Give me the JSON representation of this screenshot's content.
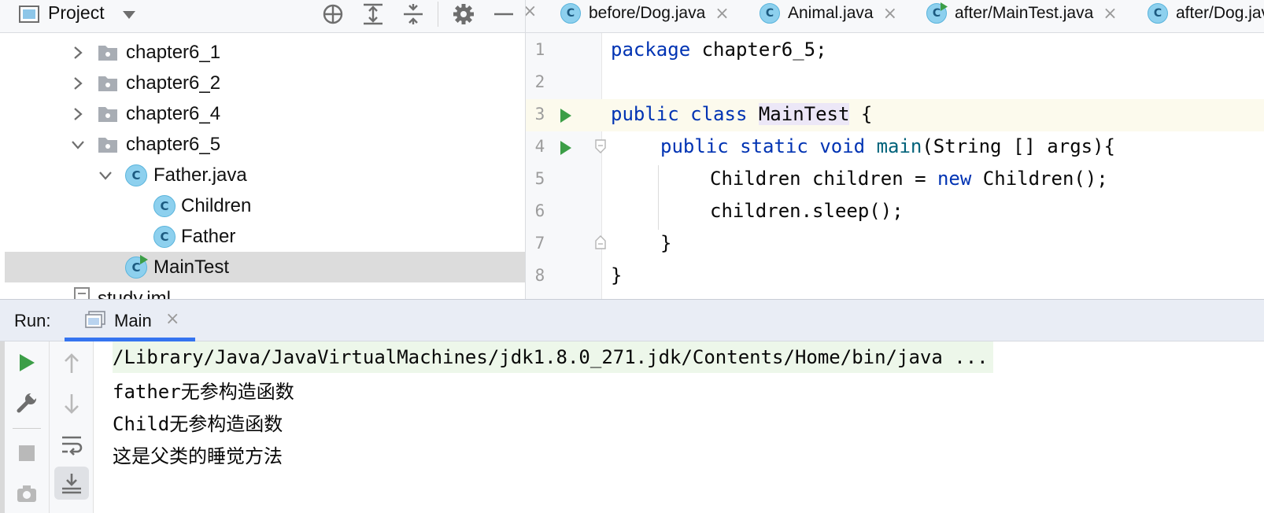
{
  "project": {
    "title": "Project",
    "tree": [
      {
        "label": "chapter6_1",
        "type": "folder",
        "expanded": false
      },
      {
        "label": "chapter6_2",
        "type": "folder",
        "expanded": false
      },
      {
        "label": "chapter6_4",
        "type": "folder",
        "expanded": false
      },
      {
        "label": "chapter6_5",
        "type": "folder",
        "expanded": true
      },
      {
        "label": "Father.java",
        "type": "java-file",
        "expanded": true
      },
      {
        "label": "Children",
        "type": "class"
      },
      {
        "label": "Father",
        "type": "class"
      },
      {
        "label": "MainTest",
        "type": "runnable-class",
        "selected": true
      },
      {
        "label": "study.iml",
        "type": "iml-file"
      }
    ]
  },
  "editor": {
    "tabs": [
      {
        "label": "before/Dog.java",
        "icon": "class-icon"
      },
      {
        "label": "Animal.java",
        "icon": "class-icon"
      },
      {
        "label": "after/MainTest.java",
        "icon": "runnable-class-icon"
      },
      {
        "label": "after/Dog.java",
        "icon": "class-icon"
      }
    ],
    "line_numbers": [
      "1",
      "2",
      "3",
      "4",
      "5",
      "6",
      "7",
      "8"
    ],
    "code": {
      "l1_kw": "package",
      "l1_rest": " chapter6_5;",
      "l3_kw1": "public",
      "l3_kw2": "class",
      "l3_name": "MainTest",
      "l3_rest": " {",
      "l4_kw1": "public",
      "l4_kw2": "static",
      "l4_kw3": "void",
      "l4_fn": "main",
      "l4_rest": "(String [] args){",
      "l5_a": "Children children = ",
      "l5_kw": "new",
      "l5_b": " Children();",
      "l6": "children.sleep();",
      "l7": "}",
      "l8": "}"
    },
    "current_line": 3
  },
  "run": {
    "label": "Run:",
    "tab_label": "Main",
    "output": [
      "/Library/Java/JavaVirtualMachines/jdk1.8.0_271.jdk/Contents/Home/bin/java ...",
      "father无参构造函数",
      "Child无参构造函数",
      "这是父类的睡觉方法"
    ]
  },
  "colors": {
    "keyword": "#0033b3",
    "method": "#00627a",
    "run_green": "#3c9e47",
    "selection": "#dcdcdc",
    "current_line": "#fcfaed",
    "accent": "#3574f0"
  }
}
